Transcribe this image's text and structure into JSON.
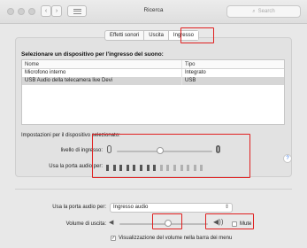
{
  "window": {
    "title": "Ricerca",
    "search_placeholder": "Search"
  },
  "tabs": [
    {
      "label": "Effetti sonori"
    },
    {
      "label": "Uscita"
    },
    {
      "label": "Ingresso"
    }
  ],
  "input": {
    "heading": "Selezionare un dispositivo per l'ingresso del suono:",
    "columns": {
      "name": "Nome",
      "type": "Tipo"
    },
    "devices": [
      {
        "name": "Microfono interno",
        "type": "Integrato"
      },
      {
        "name": "USB Audio della telecamera live Devi",
        "type": "USB"
      }
    ],
    "settings_label": "Impostazioni per il dispositivo selezionato:",
    "volume_label": "livello di ingresso:",
    "volume_level": 0.45,
    "meter_label": "Usa la porta audio per:",
    "meter_active_segments": 8,
    "meter_total_segments": 15
  },
  "output": {
    "port_label": "Usa la porta audio per:",
    "port_value": "Ingresso audio",
    "volume_label": "Volume di uscita:",
    "volume_level": 0.55,
    "mute_label": "Mute",
    "mute_checked": false,
    "menu_bar_label": "Visualizzazione del volume nella barra dei menu",
    "menu_bar_checked": true
  },
  "colors": {
    "highlight": "#e02020"
  }
}
